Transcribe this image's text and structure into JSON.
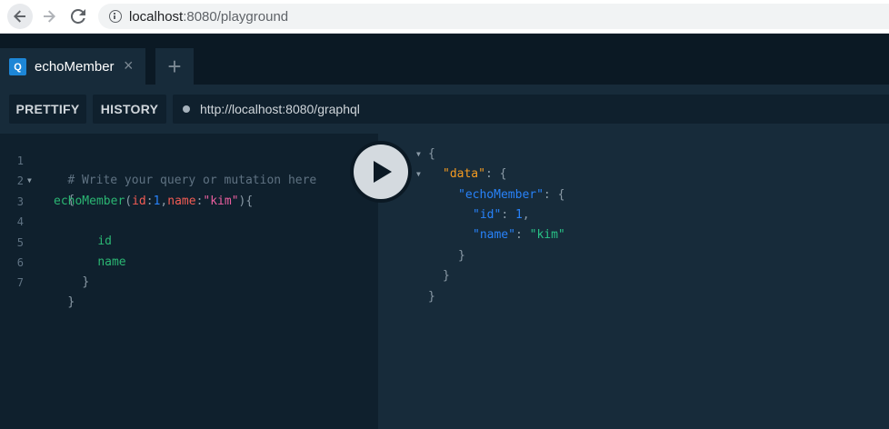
{
  "browser": {
    "url_host": "localhost",
    "url_rest": ":8080/playground"
  },
  "tabs": [
    {
      "badge": "Q",
      "title": "echoMember",
      "close": "×"
    }
  ],
  "add_tab_label": "+",
  "toolbar": {
    "prettify_label": "PRETTIFY",
    "history_label": "HISTORY",
    "endpoint_url": "http://localhost:8080/graphql"
  },
  "editor": {
    "line_numbers": [
      "1",
      "2",
      "3",
      "4",
      "5",
      "6",
      "7"
    ],
    "comment": "# Write your query or mutation here",
    "open_brace": "{",
    "close_brace": "}",
    "query_field": "echoMember",
    "arg1_name": "id",
    "arg1_value": "1",
    "arg2_name": "name",
    "arg2_value": "\"kim\"",
    "field_id": "id",
    "field_name": "name"
  },
  "result": {
    "data_key": "\"data\"",
    "member_key": "\"echoMember\"",
    "id_key": "\"id\"",
    "id_value": "1",
    "name_key": "\"name\"",
    "name_value": "\"kim\""
  },
  "icons": {
    "back": "arrow-left-icon",
    "forward": "arrow-right-icon",
    "reload": "reload-icon",
    "info": "info-icon",
    "play": "play-icon"
  },
  "colors": {
    "accent": "#1d86d6",
    "field": "#2bb673",
    "argument": "#f25c54",
    "string": "#ec5fa0",
    "number": "#2882f9",
    "data_key": "#f49b21"
  }
}
